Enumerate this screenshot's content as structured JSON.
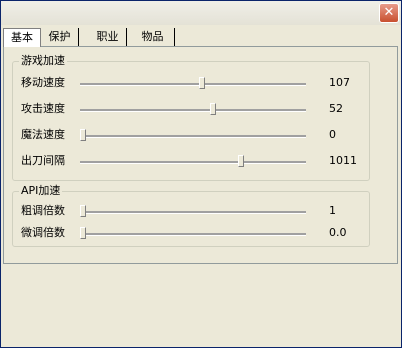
{
  "tabs": [
    "基本",
    "保护",
    "职业",
    "物品"
  ],
  "active_tab": 0,
  "groups": [
    {
      "title": "游戏加速",
      "rows": [
        {
          "label": "移动速度",
          "value": "107",
          "level": 0.54
        },
        {
          "label": "攻击速度",
          "value": "52",
          "level": 0.59
        },
        {
          "label": "魔法速度",
          "value": "0",
          "level": 0.0
        },
        {
          "label": "出刀间隔",
          "value": "1011",
          "level": 0.72
        }
      ]
    },
    {
      "title": "API加速",
      "rows": [
        {
          "label": "粗调倍数",
          "value": "1",
          "level": 0.0
        },
        {
          "label": "微调倍数",
          "value": "0.0",
          "level": 0.0
        }
      ]
    }
  ]
}
